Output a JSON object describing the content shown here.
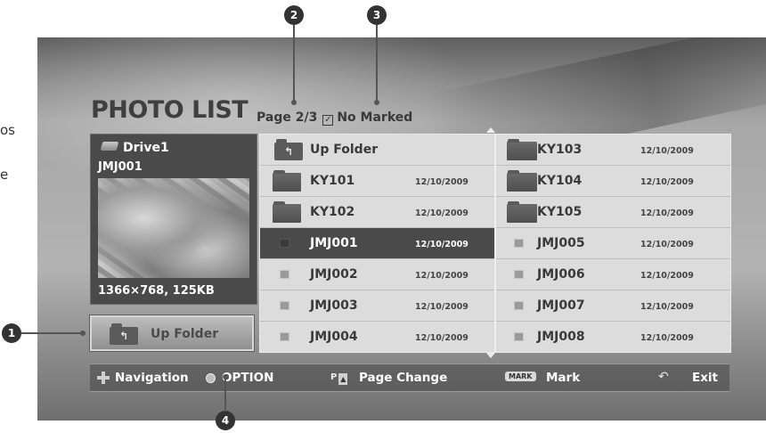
{
  "cut_text": {
    "line1": "os",
    "line2": "e"
  },
  "title": "PHOTO LIST",
  "page_info": "Page 2/3",
  "mark_status": "No Marked",
  "preview": {
    "drive": "Drive1",
    "filename": "JMJ001",
    "info": "1366×768, 125KB"
  },
  "up_folder_button": "Up Folder",
  "files_left": [
    {
      "name": "Up Folder",
      "date": "",
      "type": "up"
    },
    {
      "name": "KY101",
      "date": "12/10/2009",
      "type": "folder"
    },
    {
      "name": "KY102",
      "date": "12/10/2009",
      "type": "folder"
    },
    {
      "name": "JMJ001",
      "date": "12/10/2009",
      "type": "photo",
      "selected": true
    },
    {
      "name": "JMJ002",
      "date": "12/10/2009",
      "type": "photo"
    },
    {
      "name": "JMJ003",
      "date": "12/10/2009",
      "type": "photo"
    },
    {
      "name": "JMJ004",
      "date": "12/10/2009",
      "type": "photo"
    }
  ],
  "files_right": [
    {
      "name": "KY103",
      "date": "12/10/2009",
      "type": "folder"
    },
    {
      "name": "KY104",
      "date": "12/10/2009",
      "type": "folder"
    },
    {
      "name": "KY105",
      "date": "12/10/2009",
      "type": "folder"
    },
    {
      "name": "JMJ005",
      "date": "12/10/2009",
      "type": "photo"
    },
    {
      "name": "JMJ006",
      "date": "12/10/2009",
      "type": "photo"
    },
    {
      "name": "JMJ007",
      "date": "12/10/2009",
      "type": "photo"
    },
    {
      "name": "JMJ008",
      "date": "12/10/2009",
      "type": "photo"
    }
  ],
  "bottom_bar": {
    "navigation": "Navigation",
    "option": "OPTION",
    "page_change": "Page Change",
    "mark_key": "MARK",
    "mark": "Mark",
    "exit": "Exit"
  },
  "callouts": {
    "c1": "1",
    "c2": "2",
    "c3": "3",
    "c4": "4"
  },
  "colors": {
    "selected_row": "#4a4a4a",
    "panel": "#dcdcdc",
    "callout": "#333333"
  }
}
